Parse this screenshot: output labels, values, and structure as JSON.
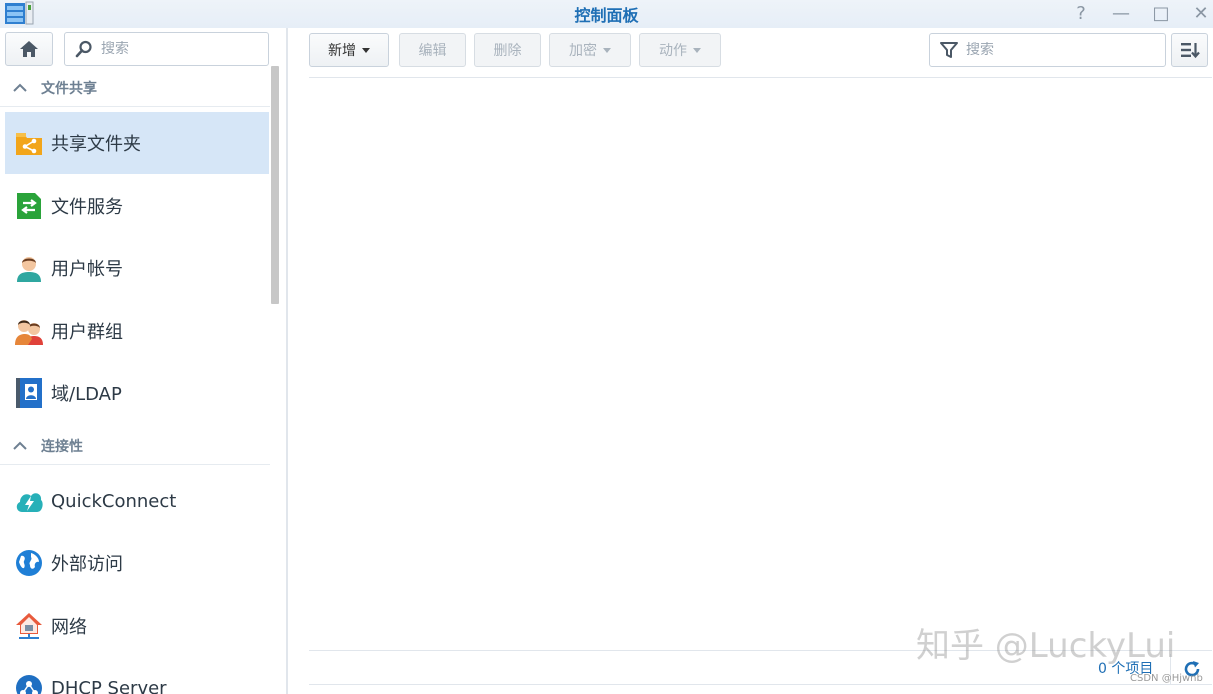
{
  "window": {
    "title": "控制面板",
    "controls": {
      "help": "?",
      "minimize": "—",
      "maximize": "□",
      "close": "✕"
    }
  },
  "sidebar": {
    "search_placeholder": "搜索",
    "sections": [
      {
        "title": "文件共享",
        "items": [
          {
            "label": "共享文件夹",
            "icon": "shared-folder-icon",
            "active": true
          },
          {
            "label": "文件服务",
            "icon": "file-services-icon"
          },
          {
            "label": "用户帐号",
            "icon": "user-icon"
          },
          {
            "label": "用户群组",
            "icon": "group-icon"
          },
          {
            "label": "域/LDAP",
            "icon": "domain-ldap-icon"
          }
        ]
      },
      {
        "title": "连接性",
        "items": [
          {
            "label": "QuickConnect",
            "icon": "quickconnect-icon"
          },
          {
            "label": "外部访问",
            "icon": "external-access-icon"
          },
          {
            "label": "网络",
            "icon": "network-icon"
          },
          {
            "label": "DHCP Server",
            "icon": "dhcp-icon"
          }
        ]
      }
    ]
  },
  "toolbar": {
    "new_label": "新增",
    "edit_label": "编辑",
    "delete_label": "删除",
    "encrypt_label": "加密",
    "action_label": "动作",
    "filter_placeholder": "搜索"
  },
  "status": {
    "item_count": "0 个项目"
  },
  "watermark": {
    "text": "知乎 @LuckyLui",
    "source": "CSDN @Hjwnb"
  },
  "colors": {
    "accent": "#1f6fb5",
    "active_bg": "#d6e6f7"
  }
}
